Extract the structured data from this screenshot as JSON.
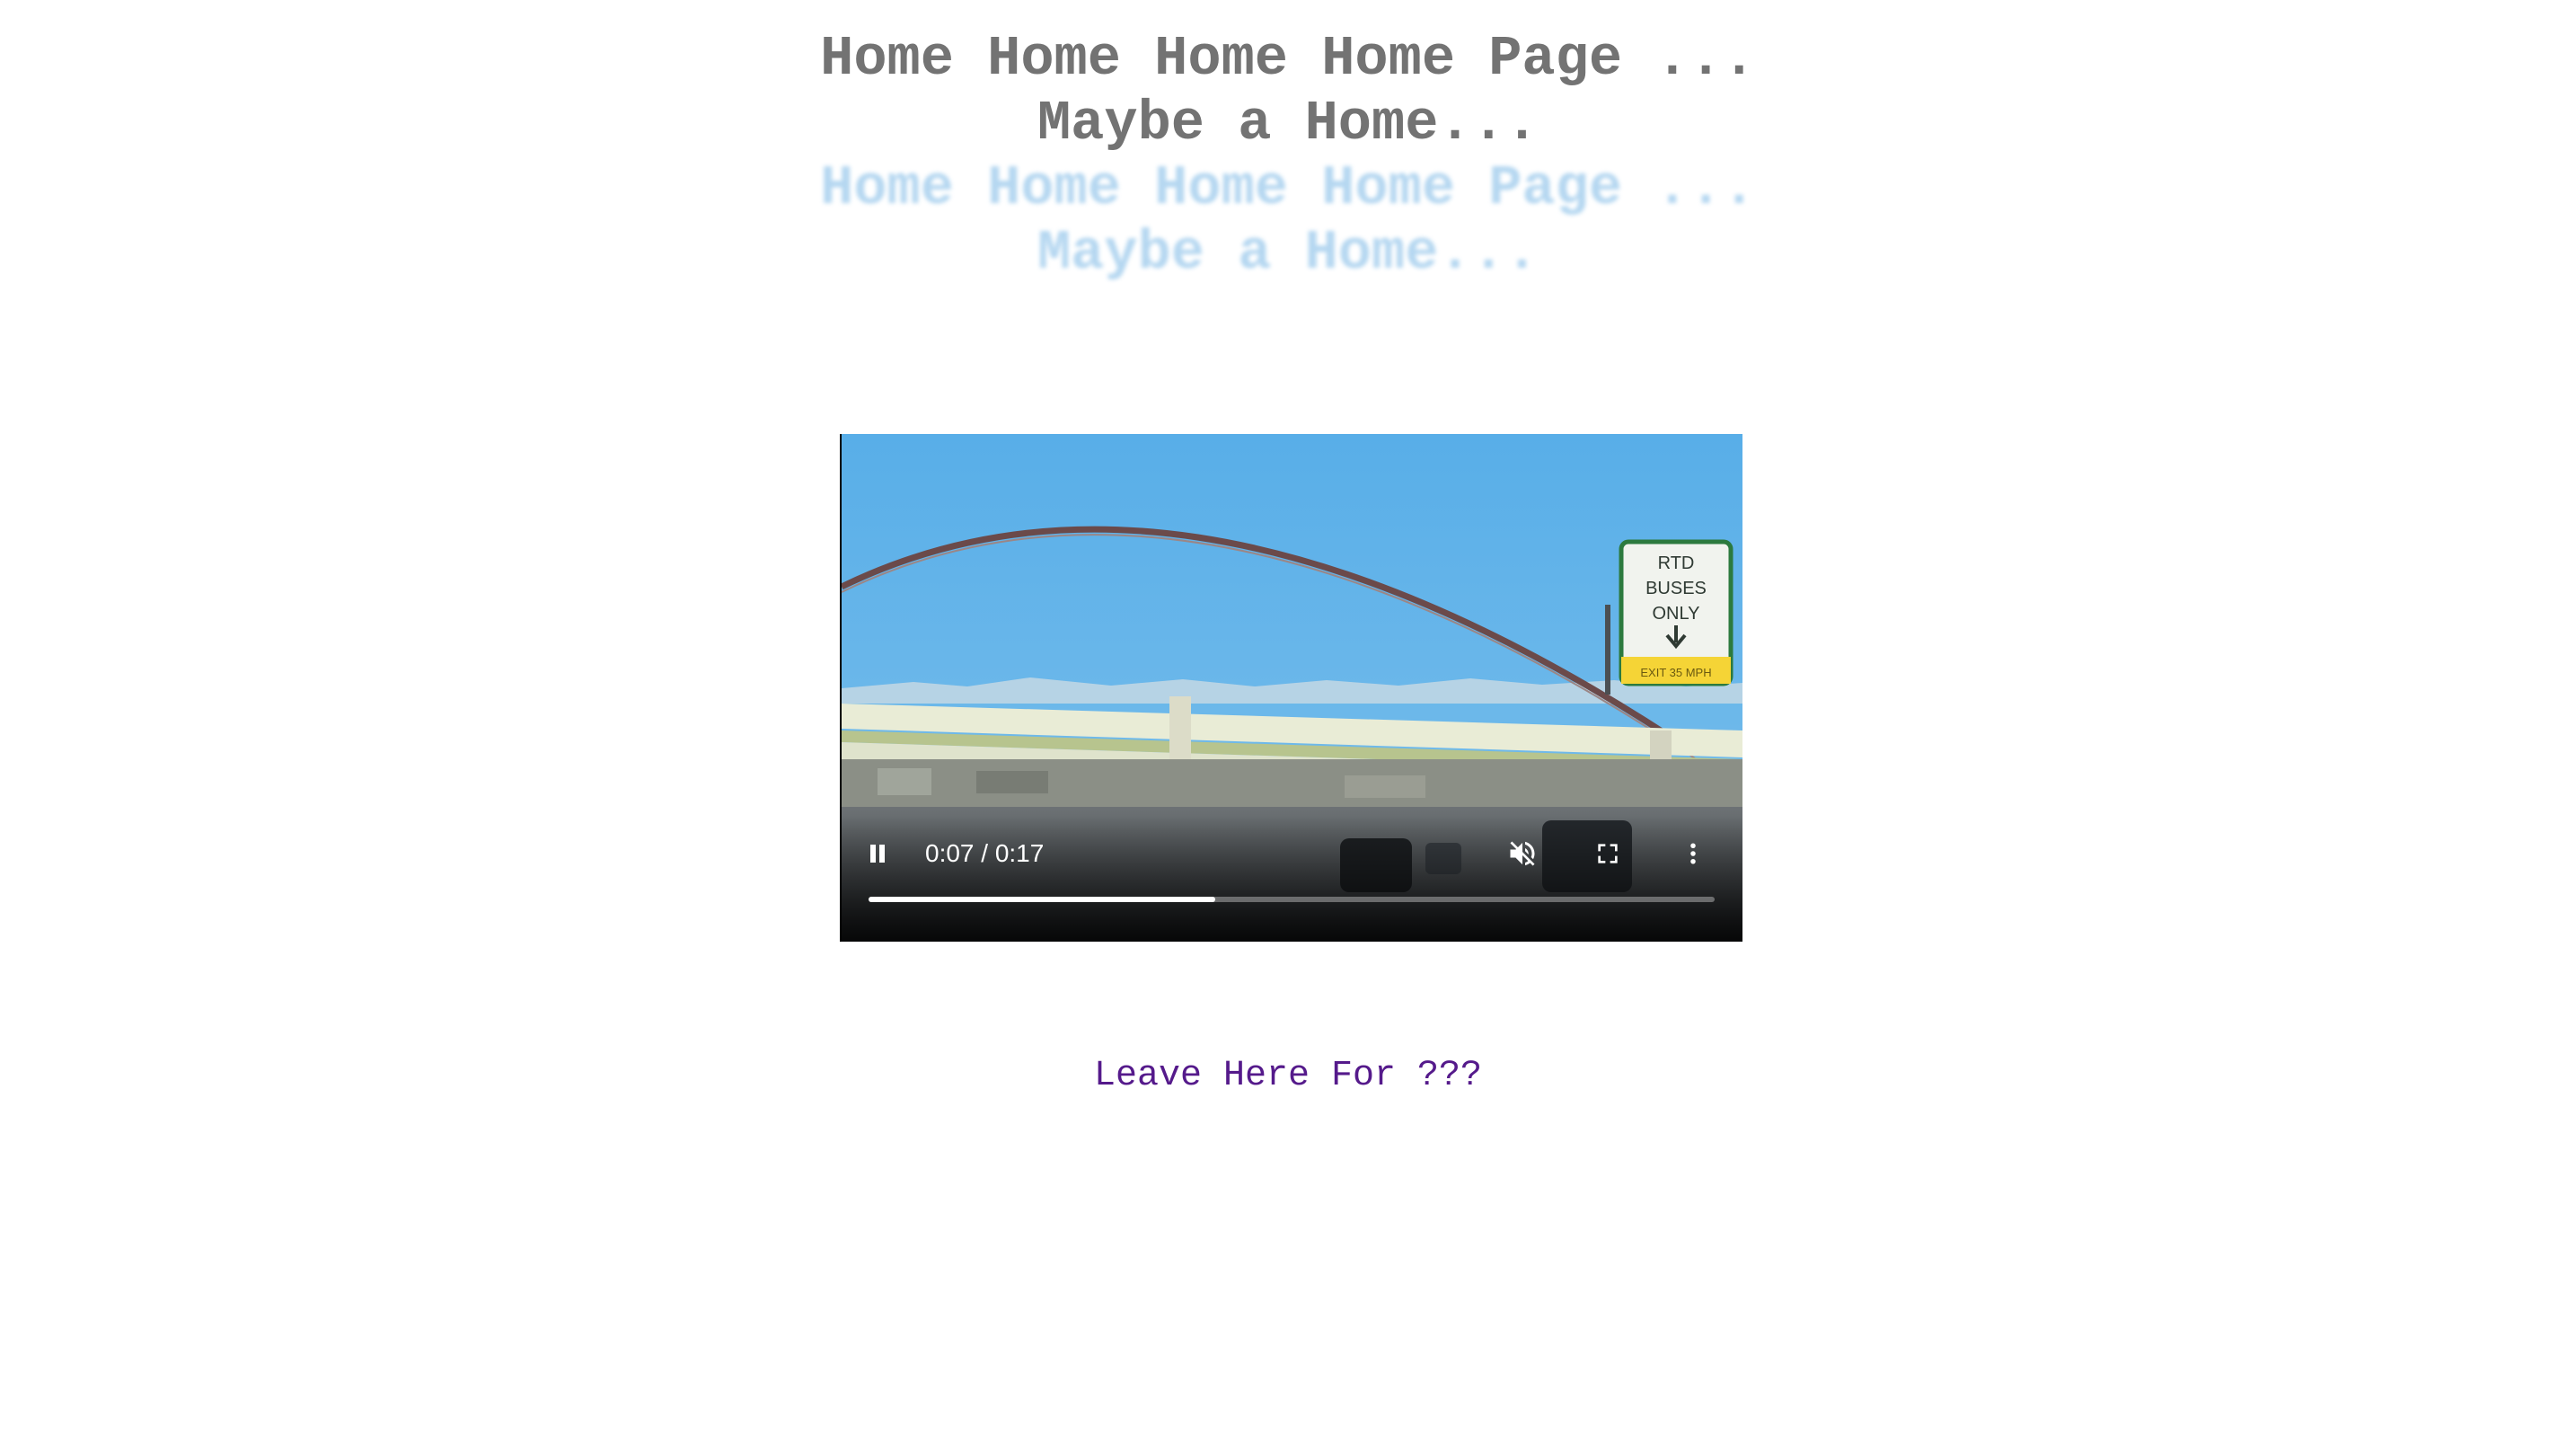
{
  "heading": {
    "line1": "Home Home Home Home Page ...",
    "line2": "Maybe a Home..."
  },
  "heading_reflection": {
    "line1": "Home Home Home Home Page ...",
    "line2": "Maybe a Home..."
  },
  "video": {
    "current_time": "0:07",
    "duration": "0:17",
    "time_display": "0:07 / 0:17",
    "progress_fraction": 0.41,
    "state": "playing",
    "muted": true,
    "sign_text": [
      "RTD",
      "BUSES",
      "ONLY"
    ],
    "sign_subtext": "EXIT 35 MPH",
    "icons": {
      "play_pause": "pause-icon",
      "volume": "volume-muted-icon",
      "fullscreen": "fullscreen-icon",
      "more": "more-vert-icon"
    }
  },
  "link": {
    "text": "Leave Here For ???"
  },
  "colors": {
    "heading": "#737373",
    "reflection": "#a8d0ee",
    "link": "#551a8b",
    "sky": "#5fb0e6"
  }
}
